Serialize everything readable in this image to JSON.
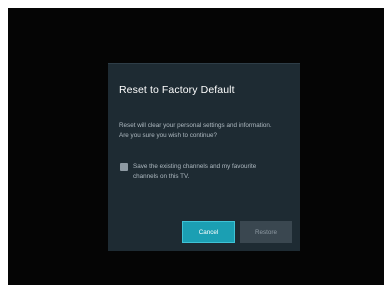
{
  "dialog": {
    "title": "Reset to Factory Default",
    "message_line1": "Reset will clear your personal settings and information.",
    "message_line2": "Are you sure you wish to continue?",
    "checkbox": {
      "checked": false,
      "label_line1": "Save the existing channels and my favourite",
      "label_line2": "channels on this TV."
    },
    "buttons": {
      "cancel_label": "Cancel",
      "restore_label": "Restore",
      "focused": "Cancel"
    }
  },
  "colors": {
    "background": "#050505",
    "dialog": "#1e2b33",
    "accent": "#1b9fb3",
    "disabled_button": "#3a4750"
  }
}
